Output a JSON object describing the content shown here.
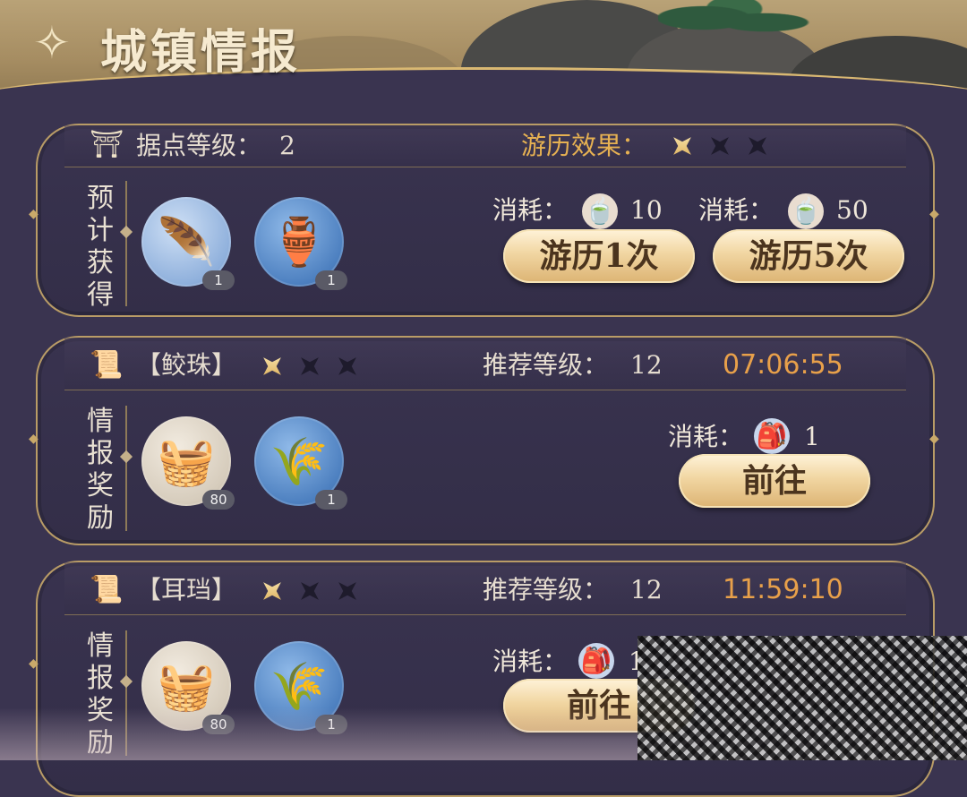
{
  "header": {
    "title": "城镇情报"
  },
  "stronghold": {
    "level_label": "据点等级：",
    "level_value": "2",
    "effect_label": "游历效果：",
    "effect_stars": [
      true,
      false,
      false
    ],
    "gain_label": [
      "预",
      "计",
      "获",
      "得"
    ],
    "items": [
      {
        "icon": "feather-icon",
        "glyph": "🪶",
        "qty": "1"
      },
      {
        "icon": "vase-icon",
        "glyph": "🏺",
        "qty": "1"
      }
    ],
    "costs": [
      {
        "label": "消耗：",
        "icon": "bowl-icon",
        "glyph": "🍵",
        "value": "10",
        "button": "游历1次"
      },
      {
        "label": "消耗：",
        "icon": "bowl-icon",
        "glyph": "🍵",
        "value": "50",
        "button": "游历5次"
      }
    ]
  },
  "intel": [
    {
      "name": "【鲛珠】",
      "stars": [
        true,
        false,
        false
      ],
      "rec_label": "推荐等级：",
      "rec_value": "12",
      "timer": "07:06:55",
      "reward_label": [
        "情",
        "报",
        "奖",
        "励"
      ],
      "items": [
        {
          "icon": "grain-basket-icon",
          "glyph": "🧺",
          "qty": "80"
        },
        {
          "icon": "reed-icon",
          "glyph": "🌾",
          "qty": "1"
        }
      ],
      "cost_label": "消耗：",
      "cost_icon": "scroll-bundle-icon",
      "cost_glyph": "🎒",
      "cost_value": "1",
      "button": "前往"
    },
    {
      "name": "【耳珰】",
      "stars": [
        true,
        false,
        false
      ],
      "rec_label": "推荐等级：",
      "rec_value": "12",
      "timer": "11:59:10",
      "reward_label": [
        "情",
        "报",
        "奖",
        "励"
      ],
      "items": [
        {
          "icon": "grain-basket-icon",
          "glyph": "🧺",
          "qty": "80"
        },
        {
          "icon": "reed-icon",
          "glyph": "🌾",
          "qty": "1"
        }
      ],
      "cost_label": "消耗：",
      "cost_icon": "scroll-bundle-icon",
      "cost_glyph": "🎒",
      "cost_value": "1",
      "button": "前往"
    }
  ]
}
